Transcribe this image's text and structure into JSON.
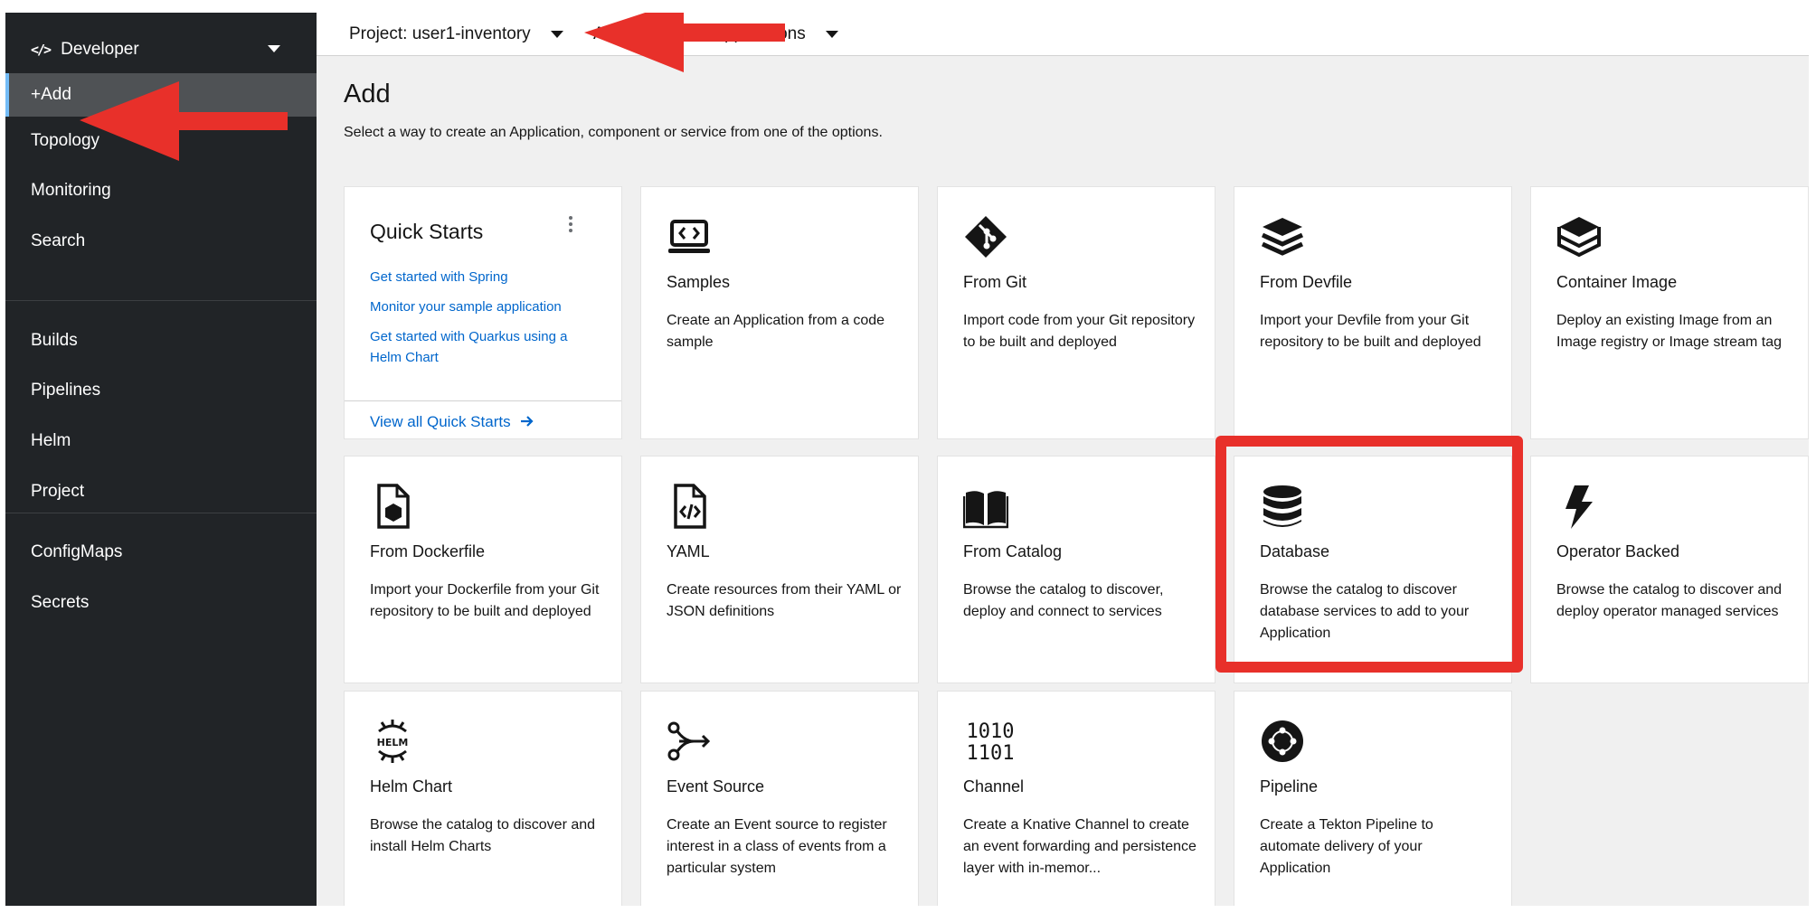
{
  "sidebar": {
    "perspective": {
      "label": "Developer",
      "icon": "code-icon"
    },
    "items": [
      {
        "label": "+Add",
        "active": true
      },
      {
        "label": "Topology"
      },
      {
        "label": "Monitoring"
      },
      {
        "label": "Search"
      },
      {
        "label": "Builds"
      },
      {
        "label": "Pipelines"
      },
      {
        "label": "Helm"
      },
      {
        "label": "Project"
      },
      {
        "label": "ConfigMaps"
      },
      {
        "label": "Secrets"
      }
    ]
  },
  "topbar": {
    "project_label": "Project: user1-inventory",
    "application_label_left": "A",
    "application_label_right": "ll applications"
  },
  "main": {
    "title": "Add",
    "description": "Select a way to create an Application, component or service from one of the options."
  },
  "quick_starts": {
    "title": "Quick Starts",
    "links": [
      "Get started with Spring",
      "Monitor your sample application",
      "Get started with Quarkus using a Helm Chart"
    ],
    "view_all": "View all Quick Starts"
  },
  "cards": [
    {
      "title": "Samples",
      "description": "Create an Application from a code sample",
      "icon": "laptop-code-icon"
    },
    {
      "title": "From Git",
      "description": "Import code from your Git repository to be built and deployed",
      "icon": "git-icon"
    },
    {
      "title": "From Devfile",
      "description": "Import your Devfile from your Git repository to be built and deployed",
      "icon": "layers-icon"
    },
    {
      "title": "Container Image",
      "description": "Deploy an existing Image from an Image registry or Image stream tag",
      "icon": "container-layers-icon"
    },
    {
      "title": "From Dockerfile",
      "description": "Import your Dockerfile from your Git repository to be built and deployed",
      "icon": "dockerfile-icon"
    },
    {
      "title": "YAML",
      "description": "Create resources from their YAML or JSON definitions",
      "icon": "file-code-icon"
    },
    {
      "title": "From Catalog",
      "description": "Browse the catalog to discover, deploy and connect to services",
      "icon": "book-icon"
    },
    {
      "title": "Database",
      "description": "Browse the catalog to discover database services to add to your Application",
      "icon": "database-icon"
    },
    {
      "title": "Operator Backed",
      "description": "Browse the catalog to discover and deploy operator managed services",
      "icon": "bolt-icon"
    },
    {
      "title": "Helm Chart",
      "description": "Browse the catalog to discover and install Helm Charts",
      "icon": "helm-icon"
    },
    {
      "title": "Event Source",
      "description": "Create an Event source to register interest in a class of events from a particular system",
      "icon": "event-source-icon"
    },
    {
      "title": "Channel",
      "description": "Create a Knative Channel to create an event forwarding and persistence layer with in-memor...",
      "icon": "binary-icon"
    },
    {
      "title": "Pipeline",
      "description": "Create a Tekton Pipeline to automate delivery of your Application",
      "icon": "pipeline-icon"
    }
  ],
  "colors": {
    "sidebar_bg": "#212427",
    "active_nav_bg": "#4f5255",
    "link": "#0066cc",
    "annotation_red": "#e8302a"
  }
}
